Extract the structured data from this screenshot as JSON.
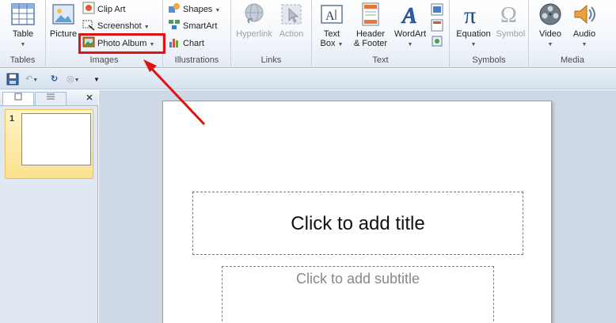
{
  "ribbon": {
    "groups": {
      "tables": {
        "label": "Tables",
        "table": {
          "label": "Table",
          "icon": "table-icon"
        }
      },
      "images": {
        "label": "Images",
        "picture": {
          "label": "Picture",
          "icon": "picture-icon"
        },
        "clip_art": {
          "label": "Clip Art",
          "icon": "clip-art-icon"
        },
        "screenshot": {
          "label": "Screenshot",
          "icon": "screenshot-icon"
        },
        "photo_album": {
          "label": "Photo Album",
          "icon": "photo-album-icon"
        }
      },
      "illustrations": {
        "label": "Illustrations",
        "shapes": {
          "label": "Shapes",
          "icon": "shapes-icon"
        },
        "smartart": {
          "label": "SmartArt",
          "icon": "smartart-icon"
        },
        "chart": {
          "label": "Chart",
          "icon": "chart-icon"
        }
      },
      "links": {
        "label": "Links",
        "hyperlink": {
          "label": "Hyperlink",
          "icon": "hyperlink-icon"
        },
        "action": {
          "label": "Action",
          "icon": "action-icon"
        }
      },
      "text": {
        "label": "Text",
        "text_box": {
          "label_line1": "Text",
          "label_line2": "Box",
          "icon": "text-box-icon"
        },
        "header_footer": {
          "label_line1": "Header",
          "label_line2": "& Footer",
          "icon": "header-footer-icon"
        },
        "wordart": {
          "label": "WordArt",
          "icon": "wordart-icon"
        }
      },
      "symbols": {
        "label": "Symbols",
        "equation": {
          "label": "Equation",
          "icon": "pi-icon"
        },
        "symbol": {
          "label": "Symbol",
          "icon": "omega-icon"
        }
      },
      "media": {
        "label": "Media",
        "video": {
          "label": "Video",
          "icon": "video-icon"
        },
        "audio": {
          "label": "Audio",
          "icon": "audio-icon"
        }
      }
    }
  },
  "slides_pane": {
    "slide_number": "1"
  },
  "slide": {
    "title_placeholder": "Click to add title",
    "subtitle_placeholder": "Click to add subtitle"
  },
  "colors": {
    "highlight": "#e01212",
    "ribbon_background": "#f4f7fb",
    "thumbnail_selected": "#fbe18e",
    "edit_background": "#cfd9e6"
  }
}
